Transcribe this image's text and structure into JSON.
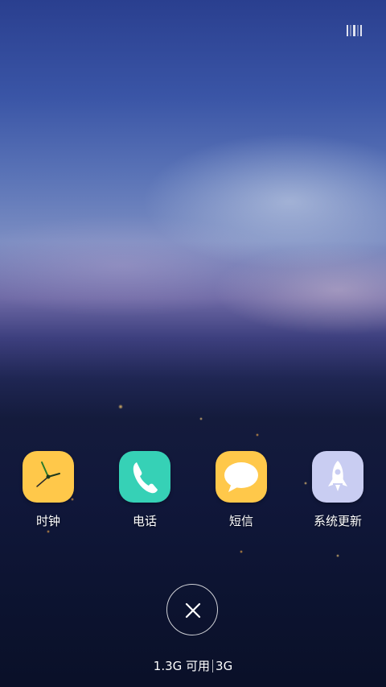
{
  "apps": [
    {
      "label": "时钟",
      "icon": "clock-icon"
    },
    {
      "label": "电话",
      "icon": "phone-icon"
    },
    {
      "label": "短信",
      "icon": "message-icon"
    },
    {
      "label": "系统更新",
      "icon": "rocket-icon"
    }
  ],
  "memory": {
    "available": "1.3G 可用",
    "total": "3G"
  },
  "colors": {
    "clock": "#ffc84a",
    "phone": "#36d1b6",
    "sms": "#ffc84a",
    "update": "#c9cdf2"
  }
}
